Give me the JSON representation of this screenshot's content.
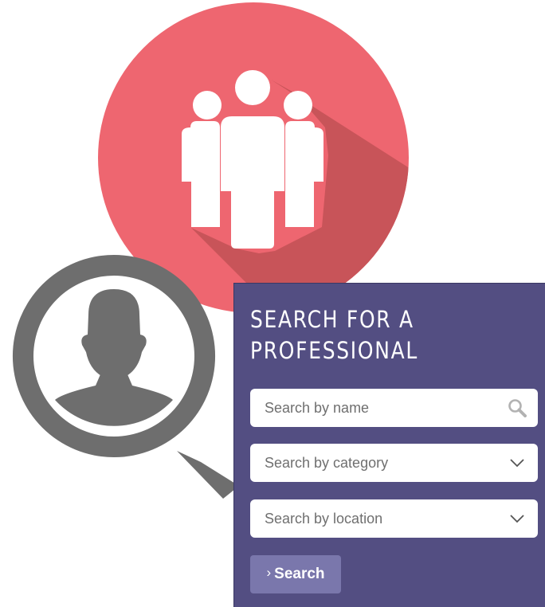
{
  "colors": {
    "group_circle": "#ee6670",
    "group_circle_shadow": "#c85459",
    "group_figures": "#ffffff",
    "magnifier": "#6e6e6e",
    "panel_background": "#534e82",
    "button_background": "#7a77ac",
    "field_background": "#ffffff",
    "placeholder_text": "#6f6f6f",
    "field_icon": "#b2b2b2"
  },
  "icons": {
    "group": "group-of-people-icon",
    "profile_search": "person-search-magnifier-icon",
    "name_field": "magnifier-icon",
    "dropdowns": "chevron-down-icon",
    "button": "chevron-right-icon"
  },
  "search_panel": {
    "title_line1": "SEARCH FOR A",
    "title_line2": "PROFESSIONAL",
    "name_placeholder": "Search by name",
    "category_placeholder": "Search by category",
    "location_placeholder": "Search by location",
    "button_chevron": "›",
    "button_label": "Search"
  }
}
